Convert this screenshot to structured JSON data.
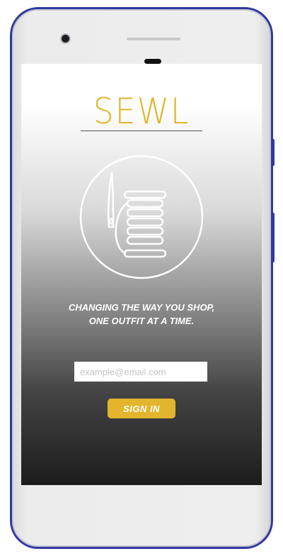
{
  "app": {
    "brand": "SEWL",
    "logo_icon": "thread-spool-needle-icon",
    "tagline_line1": "CHANGING THE WAY YOU SHOP,",
    "tagline_line2": "ONE OUTFIT AT A TIME."
  },
  "login": {
    "email_placeholder": "example@email.com",
    "email_value": "",
    "signin_label": "SIGN IN"
  },
  "colors": {
    "accent": "#e2b52c",
    "device_frame": "#2f3a9e"
  }
}
